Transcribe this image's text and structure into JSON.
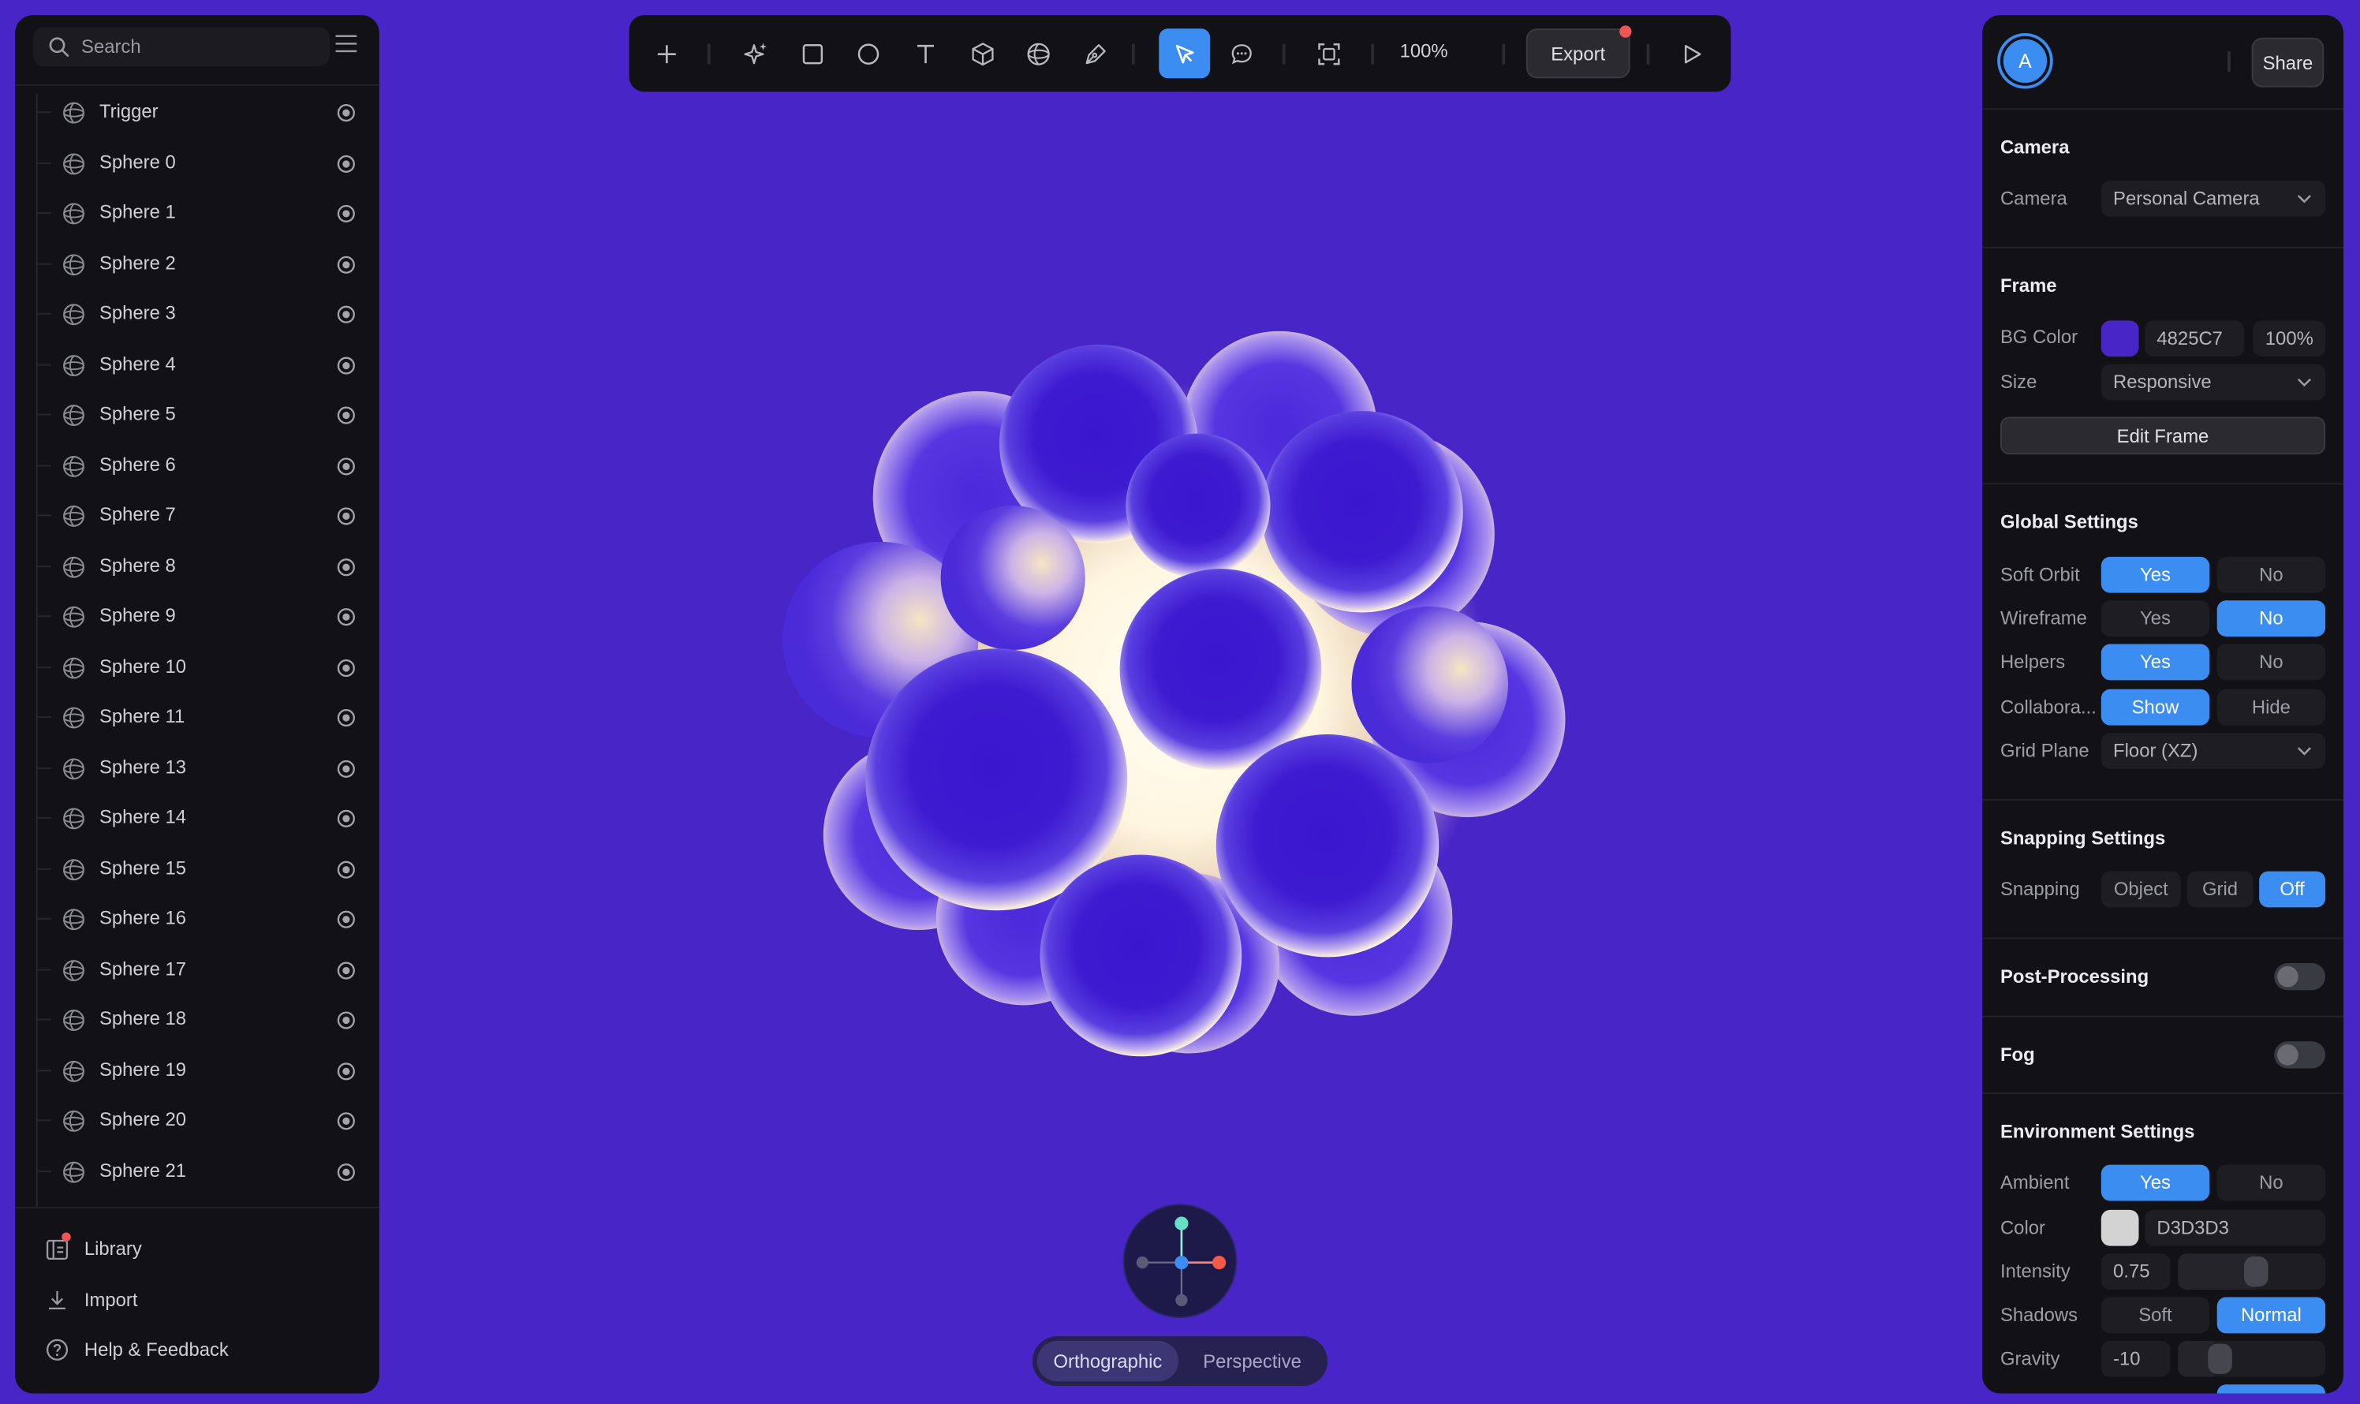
{
  "left_panel": {
    "search_placeholder": "Search",
    "layers": [
      {
        "name": "Trigger"
      },
      {
        "name": "Sphere 0"
      },
      {
        "name": "Sphere 1"
      },
      {
        "name": "Sphere 2"
      },
      {
        "name": "Sphere 3"
      },
      {
        "name": "Sphere 4"
      },
      {
        "name": "Sphere 5"
      },
      {
        "name": "Sphere 6"
      },
      {
        "name": "Sphere 7"
      },
      {
        "name": "Sphere 8"
      },
      {
        "name": "Sphere 9"
      },
      {
        "name": "Sphere 10"
      },
      {
        "name": "Sphere 11"
      },
      {
        "name": "Sphere 13"
      },
      {
        "name": "Sphere 14"
      },
      {
        "name": "Sphere 15"
      },
      {
        "name": "Sphere 16"
      },
      {
        "name": "Sphere 17"
      },
      {
        "name": "Sphere 18"
      },
      {
        "name": "Sphere 19"
      },
      {
        "name": "Sphere 20"
      },
      {
        "name": "Sphere 21"
      }
    ],
    "layer_icon": "globe-icon",
    "visibility_icon": "visibility-icon",
    "bottom": {
      "library": "Library",
      "import": "Import",
      "help": "Help & Feedback"
    }
  },
  "toolbar": {
    "tools": [
      "add-icon",
      "sparkle-icon",
      "rectangle-icon",
      "circle-icon",
      "text-icon",
      "cube-icon",
      "sphere-icon",
      "pen-icon",
      "cursor-icon",
      "comment-icon",
      "frame-icon",
      "play-icon"
    ],
    "zoom": "100%",
    "export_label": "Export"
  },
  "viewport": {
    "view_modes": {
      "active": "Orthographic",
      "inactive": "Perspective"
    }
  },
  "right_panel": {
    "avatar_initial": "A",
    "share_label": "Share",
    "camera": {
      "title": "Camera",
      "label": "Camera",
      "value": "Personal Camera"
    },
    "frame": {
      "title": "Frame",
      "bg_label": "BG Color",
      "bg_hex": "4825C7",
      "bg_opacity": "100%",
      "size_label": "Size",
      "size_value": "Responsive",
      "edit_label": "Edit Frame"
    },
    "global": {
      "title": "Global Settings",
      "soft_orbit": {
        "label": "Soft Orbit",
        "a": "Yes",
        "b": "No",
        "selected": "Yes"
      },
      "wireframe": {
        "label": "Wireframe",
        "a": "Yes",
        "b": "No",
        "selected": "No"
      },
      "helpers": {
        "label": "Helpers",
        "a": "Yes",
        "b": "No",
        "selected": "Yes"
      },
      "collaboration": {
        "label": "Collabora...",
        "a": "Show",
        "b": "Hide",
        "selected": "Show"
      },
      "grid_plane": {
        "label": "Grid Plane",
        "value": "Floor (XZ)"
      }
    },
    "snapping": {
      "title": "Snapping Settings",
      "label": "Snapping",
      "options": [
        "Object",
        "Grid",
        "Off"
      ],
      "selected": "Off"
    },
    "post_processing": {
      "title": "Post-Processing",
      "enabled": false
    },
    "fog": {
      "title": "Fog",
      "enabled": false
    },
    "environment": {
      "title": "Environment Settings",
      "ambient": {
        "label": "Ambient",
        "a": "Yes",
        "b": "No",
        "selected": "Yes"
      },
      "color_label": "Color",
      "color_hex": "D3D3D3",
      "intensity_label": "Intensity",
      "intensity_value": "0.75",
      "shadows": {
        "label": "Shadows",
        "a": "Soft",
        "b": "Normal",
        "selected": "Normal"
      },
      "gravity_label": "Gravity",
      "gravity_value": "-10"
    }
  },
  "colors": {
    "canvas_bg": "#4825C7",
    "accent": "#3b8df2",
    "panel": "#121216",
    "ambient_swatch": "#D3D3D3"
  }
}
